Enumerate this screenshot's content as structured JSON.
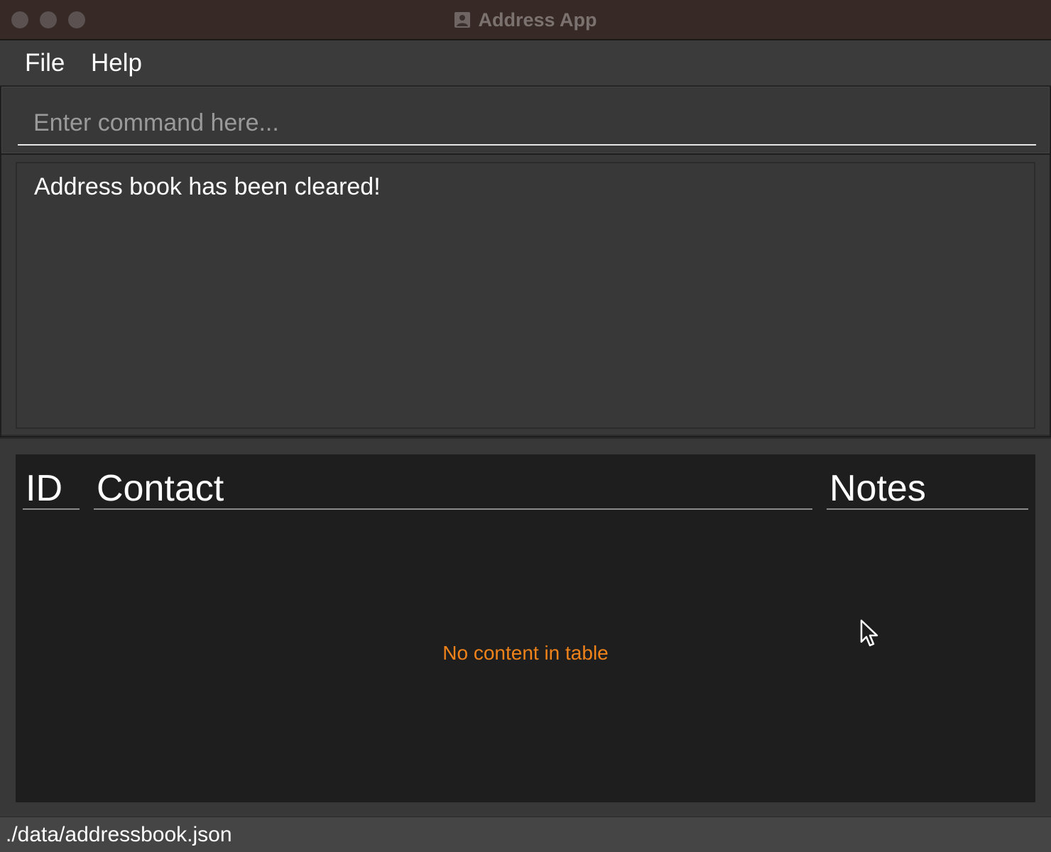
{
  "window": {
    "title": "Address App",
    "app_icon": "address-book-icon"
  },
  "menubar": {
    "items": [
      {
        "label": "File"
      },
      {
        "label": "Help"
      }
    ]
  },
  "command_box": {
    "placeholder": "Enter command here...",
    "value": ""
  },
  "result_display": {
    "text": "Address book has been cleared!"
  },
  "contact_table": {
    "columns": [
      "ID",
      "Contact",
      "Notes"
    ],
    "rows": [],
    "empty_message": "No content in table",
    "empty_message_color": "#f0821a"
  },
  "status_bar": {
    "file_path": "./data/addressbook.json"
  },
  "colors": {
    "titlebar": "#362926",
    "panel": "#383838",
    "table_background": "#1e1e1e"
  }
}
